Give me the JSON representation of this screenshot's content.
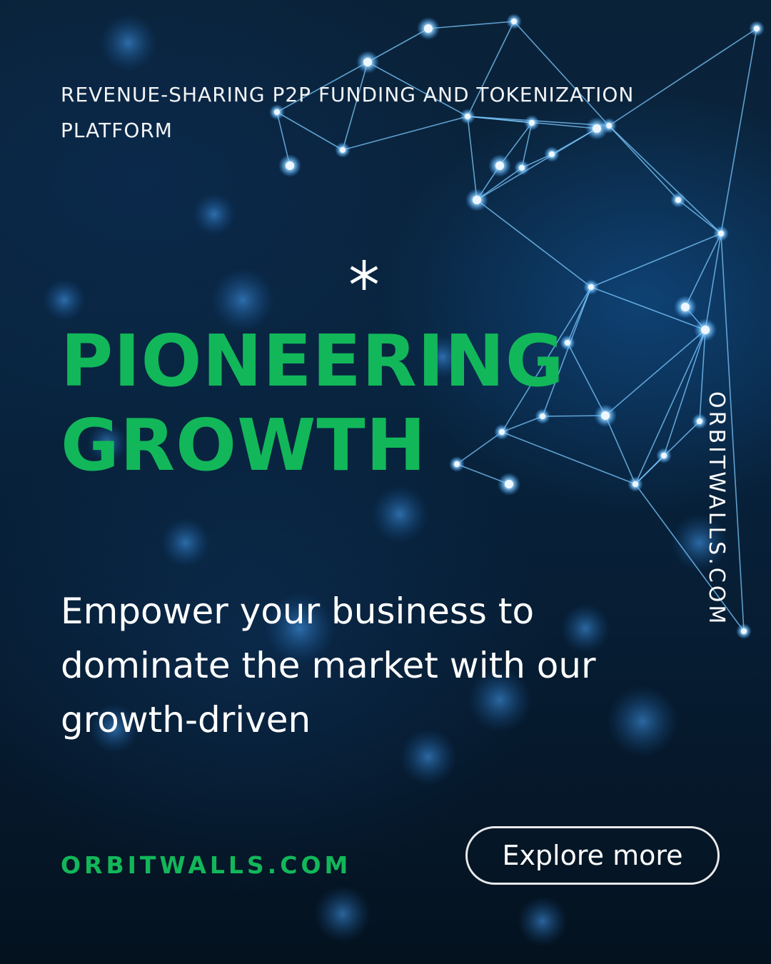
{
  "header": {
    "tagline": "REVENUE-SHARING P2P FUNDING AND TOKENIZATION PLATFORM"
  },
  "hero": {
    "headline_line1": "PIONEERING",
    "headline_line2": "GROWTH",
    "body": "Empower your business to dominate the market with our growth-driven"
  },
  "side": {
    "vertical_brand": "ORBITWALLS.COM"
  },
  "footer": {
    "brand": "ORBITWALLS.COM",
    "cta_label": "Explore more"
  },
  "colors": {
    "accent_green": "#12b75a",
    "background_navy": "#071a2c",
    "network_glow": "#6fc8ff"
  },
  "icons": {
    "decorative": "asterisk-icon",
    "background": "network-graphic"
  }
}
